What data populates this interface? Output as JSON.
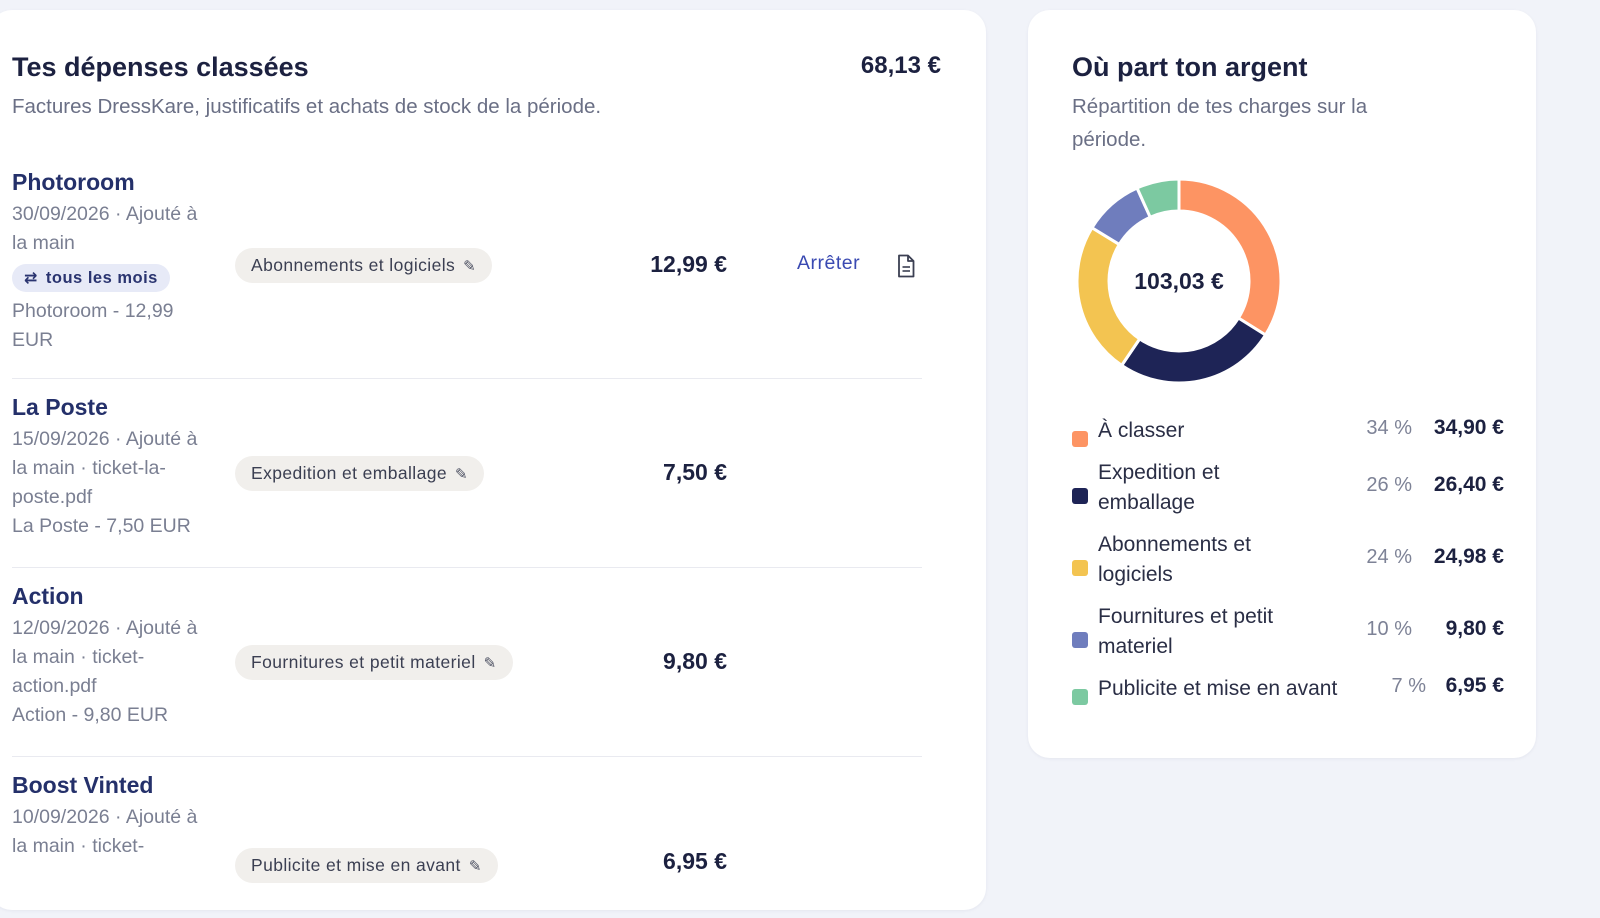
{
  "expenses": {
    "title": "Tes dépenses classées",
    "subtitle": "Factures DressKare, justificatifs et achats de stock de la période.",
    "total": "68,13 €",
    "rows": [
      {
        "name": "Photoroom",
        "meta": "30/09/2026 · Ajouté à la main",
        "recurring": "tous les mois",
        "note": "Photoroom - 12,99 EUR",
        "category": "Abonnements et logiciels",
        "amount": "12,99 €",
        "action": "Arrêter"
      },
      {
        "name": "La Poste",
        "meta": "15/09/2026 · Ajouté à la main · ticket-la-poste.pdf",
        "note": "La Poste - 7,50 EUR",
        "category": "Expedition et emballage",
        "amount": "7,50 €"
      },
      {
        "name": "Action",
        "meta": "12/09/2026 · Ajouté à la main · ticket-action.pdf",
        "note": "Action - 9,80 EUR",
        "category": "Fournitures et petit materiel",
        "amount": "9,80 €"
      },
      {
        "name": "Boost Vinted",
        "meta": "10/09/2026 · Ajouté à la main · ticket-",
        "category": "Publicite et mise en avant",
        "amount": "6,95 €"
      }
    ]
  },
  "breakdown": {
    "title": "Où part ton argent",
    "subtitle": "Répartition de tes charges sur la période.",
    "center_total": "103,03 €",
    "legend": [
      {
        "label": "À classer",
        "pct": "34 %",
        "value": "34,90 €",
        "color": "#fd9463"
      },
      {
        "label": "Expedition et emballage",
        "pct": "26 %",
        "value": "26,40 €",
        "color": "#1e2456"
      },
      {
        "label": "Abonnements et logiciels",
        "pct": "24 %",
        "value": "24,98 €",
        "color": "#f3c451"
      },
      {
        "label": "Fournitures et petit materiel",
        "pct": "10 %",
        "value": "9,80 €",
        "color": "#6f7dbd"
      },
      {
        "label": "Publicite et mise en avant",
        "pct": "7 %",
        "value": "6,95 €",
        "color": "#7cc9a1"
      }
    ]
  },
  "chart_data": {
    "type": "pie",
    "categories": [
      "À classer",
      "Expedition et emballage",
      "Abonnements et logiciels",
      "Fournitures et petit materiel",
      "Publicite et mise en avant"
    ],
    "values": [
      34.9,
      26.4,
      24.98,
      9.8,
      6.95
    ],
    "colors": [
      "#fd9463",
      "#1e2456",
      "#f3c451",
      "#6f7dbd",
      "#7cc9a1"
    ]
  }
}
